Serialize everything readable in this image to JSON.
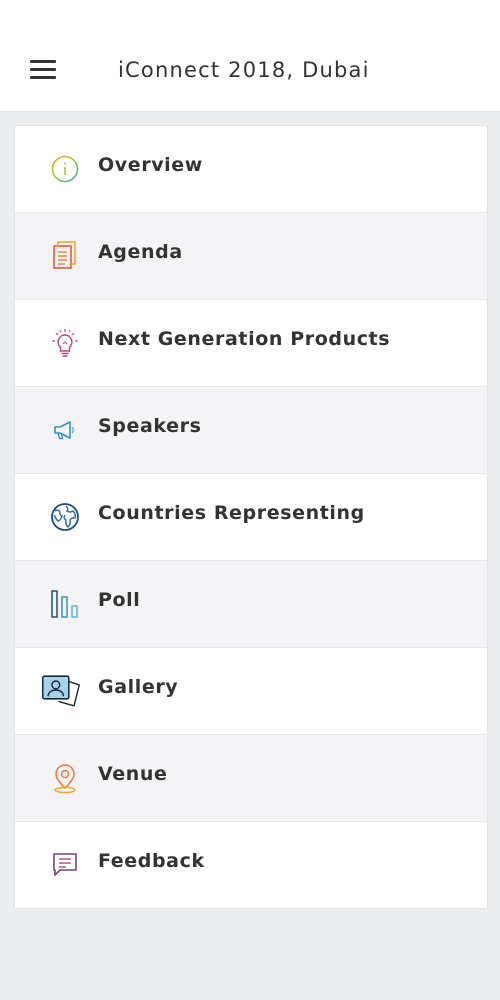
{
  "header": {
    "title": "iConnect 2018, Dubai",
    "menu_icon": "hamburger-menu-icon"
  },
  "menu": {
    "items": [
      {
        "label": "Overview",
        "icon": "info-circle-icon",
        "color": "#9bc83c"
      },
      {
        "label": "Agenda",
        "icon": "document-stack-icon",
        "color": "#f07c3c"
      },
      {
        "label": "Next Generation Products",
        "icon": "lightbulb-icon",
        "color": "#b5497f"
      },
      {
        "label": "Speakers",
        "icon": "megaphone-icon",
        "color": "#3a8fc4"
      },
      {
        "label": "Countries Representing",
        "icon": "globe-icon",
        "color": "#1f4e79"
      },
      {
        "label": "Poll",
        "icon": "bar-chart-icon",
        "color": "#3a8fc4"
      },
      {
        "label": "Gallery",
        "icon": "photo-gallery-icon",
        "color": "#1b2a3a"
      },
      {
        "label": "Venue",
        "icon": "location-pin-icon",
        "color": "#f07c3c"
      },
      {
        "label": "Feedback",
        "icon": "chat-bubble-icon",
        "color": "#7b3f8c"
      }
    ]
  }
}
